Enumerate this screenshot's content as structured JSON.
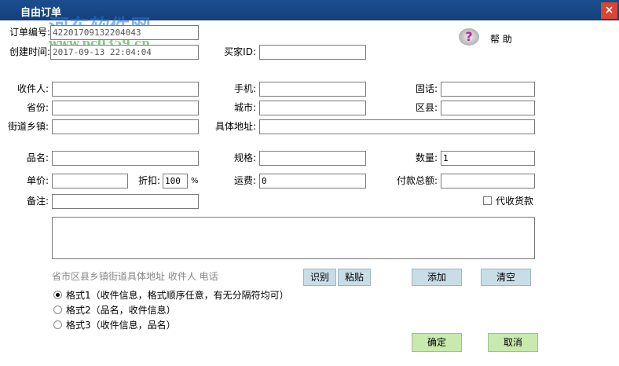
{
  "window": {
    "title": "自由订单",
    "close": "×"
  },
  "watermark": {
    "name": "河东软件网",
    "url": "www.pc0359.cn"
  },
  "help": {
    "label": "帮 助"
  },
  "fields": {
    "order_no": {
      "label": "订单编号:",
      "value": "42201709132204043"
    },
    "created": {
      "label": "创建时间:",
      "value": "2017-09-13 22:04:04"
    },
    "buyer_id": {
      "label": "买家ID:",
      "value": ""
    },
    "receiver": {
      "label": "收件人:",
      "value": ""
    },
    "mobile": {
      "label": "手机:",
      "value": ""
    },
    "phone": {
      "label": "固话:",
      "value": ""
    },
    "province": {
      "label": "省份:",
      "value": ""
    },
    "city": {
      "label": "城市:",
      "value": ""
    },
    "district": {
      "label": "区县:",
      "value": ""
    },
    "street": {
      "label": "街道乡镇:",
      "value": ""
    },
    "address": {
      "label": "具体地址:",
      "value": ""
    },
    "product": {
      "label": "品名:",
      "value": ""
    },
    "spec": {
      "label": "规格:",
      "value": ""
    },
    "quantity": {
      "label": "数量:",
      "value": "1"
    },
    "price": {
      "label": "单价:",
      "value": ""
    },
    "discount": {
      "label": "折扣:",
      "value": "100",
      "unit": "%"
    },
    "shipping": {
      "label": "运费:",
      "value": "0"
    },
    "total": {
      "label": "付款总额:",
      "value": ""
    },
    "remark": {
      "label": "备注:",
      "value": ""
    }
  },
  "cod": {
    "label": "代收货款",
    "checked": false
  },
  "hint": "省市区县乡镇街道具体地址 收件人 电话",
  "buttons": {
    "recognize": "识别",
    "paste": "粘贴",
    "add": "添加",
    "clear": "清空",
    "ok": "确定",
    "cancel": "取消"
  },
  "formats": [
    {
      "label": "格式1（收件信息，格式顺序任意，有无分隔符均可）",
      "selected": true
    },
    {
      "label": "格式2（品名，收件信息）",
      "selected": false
    },
    {
      "label": "格式3（收件信息，品名）",
      "selected": false
    }
  ]
}
